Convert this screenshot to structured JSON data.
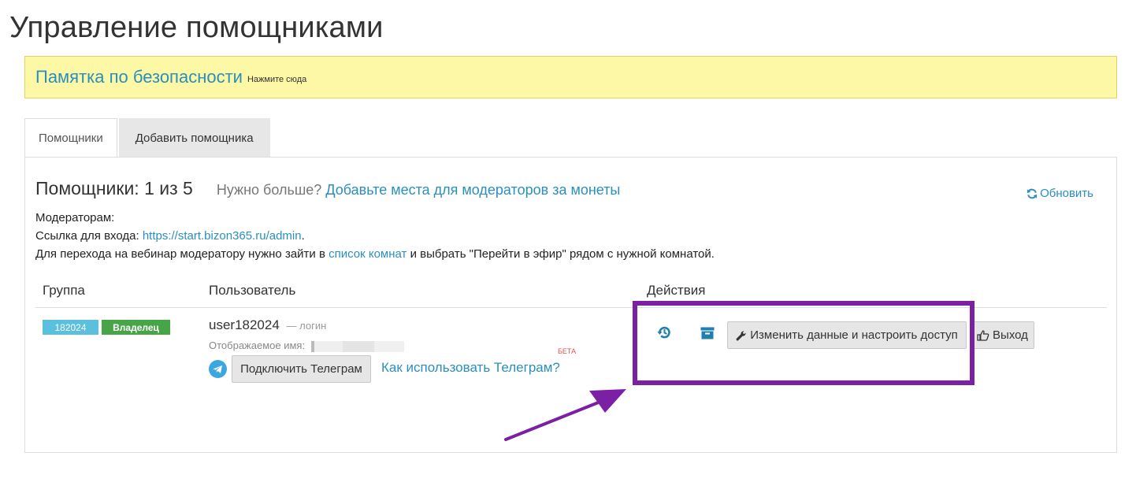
{
  "page": {
    "title": "Управление помощниками"
  },
  "banner": {
    "link_text": "Памятка по безопасности",
    "hint": "Нажмите сюда",
    "bg_color": "#fcf8a6"
  },
  "tabs": [
    {
      "label": "Помощники",
      "active": true
    },
    {
      "label": "Добавить помощника",
      "active": false
    }
  ],
  "panel": {
    "count_title": "Помощники: 1 из 5",
    "need_more": "Нужно больше?",
    "add_slots_link": "Добавьте места для модераторов за монеты",
    "refresh_label": "Обновить",
    "info": {
      "moderators_label": "Модераторам:",
      "login_link_label": "Ссылка для входа:",
      "login_link": "https://start.bizon365.ru/admin",
      "login_link_suffix": ".",
      "webinar_prefix": "Для перехода на вебинар модератору нужно зайти в",
      "rooms_link": "список комнат",
      "webinar_suffix": "и выбрать \"Перейти в эфир\" рядом с нужной комнатой."
    }
  },
  "table": {
    "headers": {
      "group": "Группа",
      "user": "Пользователь",
      "actions": "Действия"
    },
    "rows": [
      {
        "group_id": "182024",
        "role": "Владелец",
        "login": "user182024",
        "login_label": "— логин",
        "display_name_label": "Отображаемое имя:",
        "beta": "БЕТА",
        "connect_telegram": "Подключить Телеграм",
        "how_telegram": "Как использовать Телеграм?",
        "edit_access": "Изменить данные и настроить доступ",
        "logout": "Выход"
      }
    ]
  },
  "icons": {
    "history": "history-icon",
    "archive": "archive-icon",
    "wrench": "wrench-icon",
    "thumb": "thumbs-up-icon",
    "refresh": "refresh-icon",
    "telegram": "telegram-icon"
  },
  "colors": {
    "accent": "#2a8fbd",
    "badge_group": "#5bc0de",
    "badge_owner": "#47a447",
    "highlight": "#7b20a4",
    "beta": "#d9534f"
  }
}
